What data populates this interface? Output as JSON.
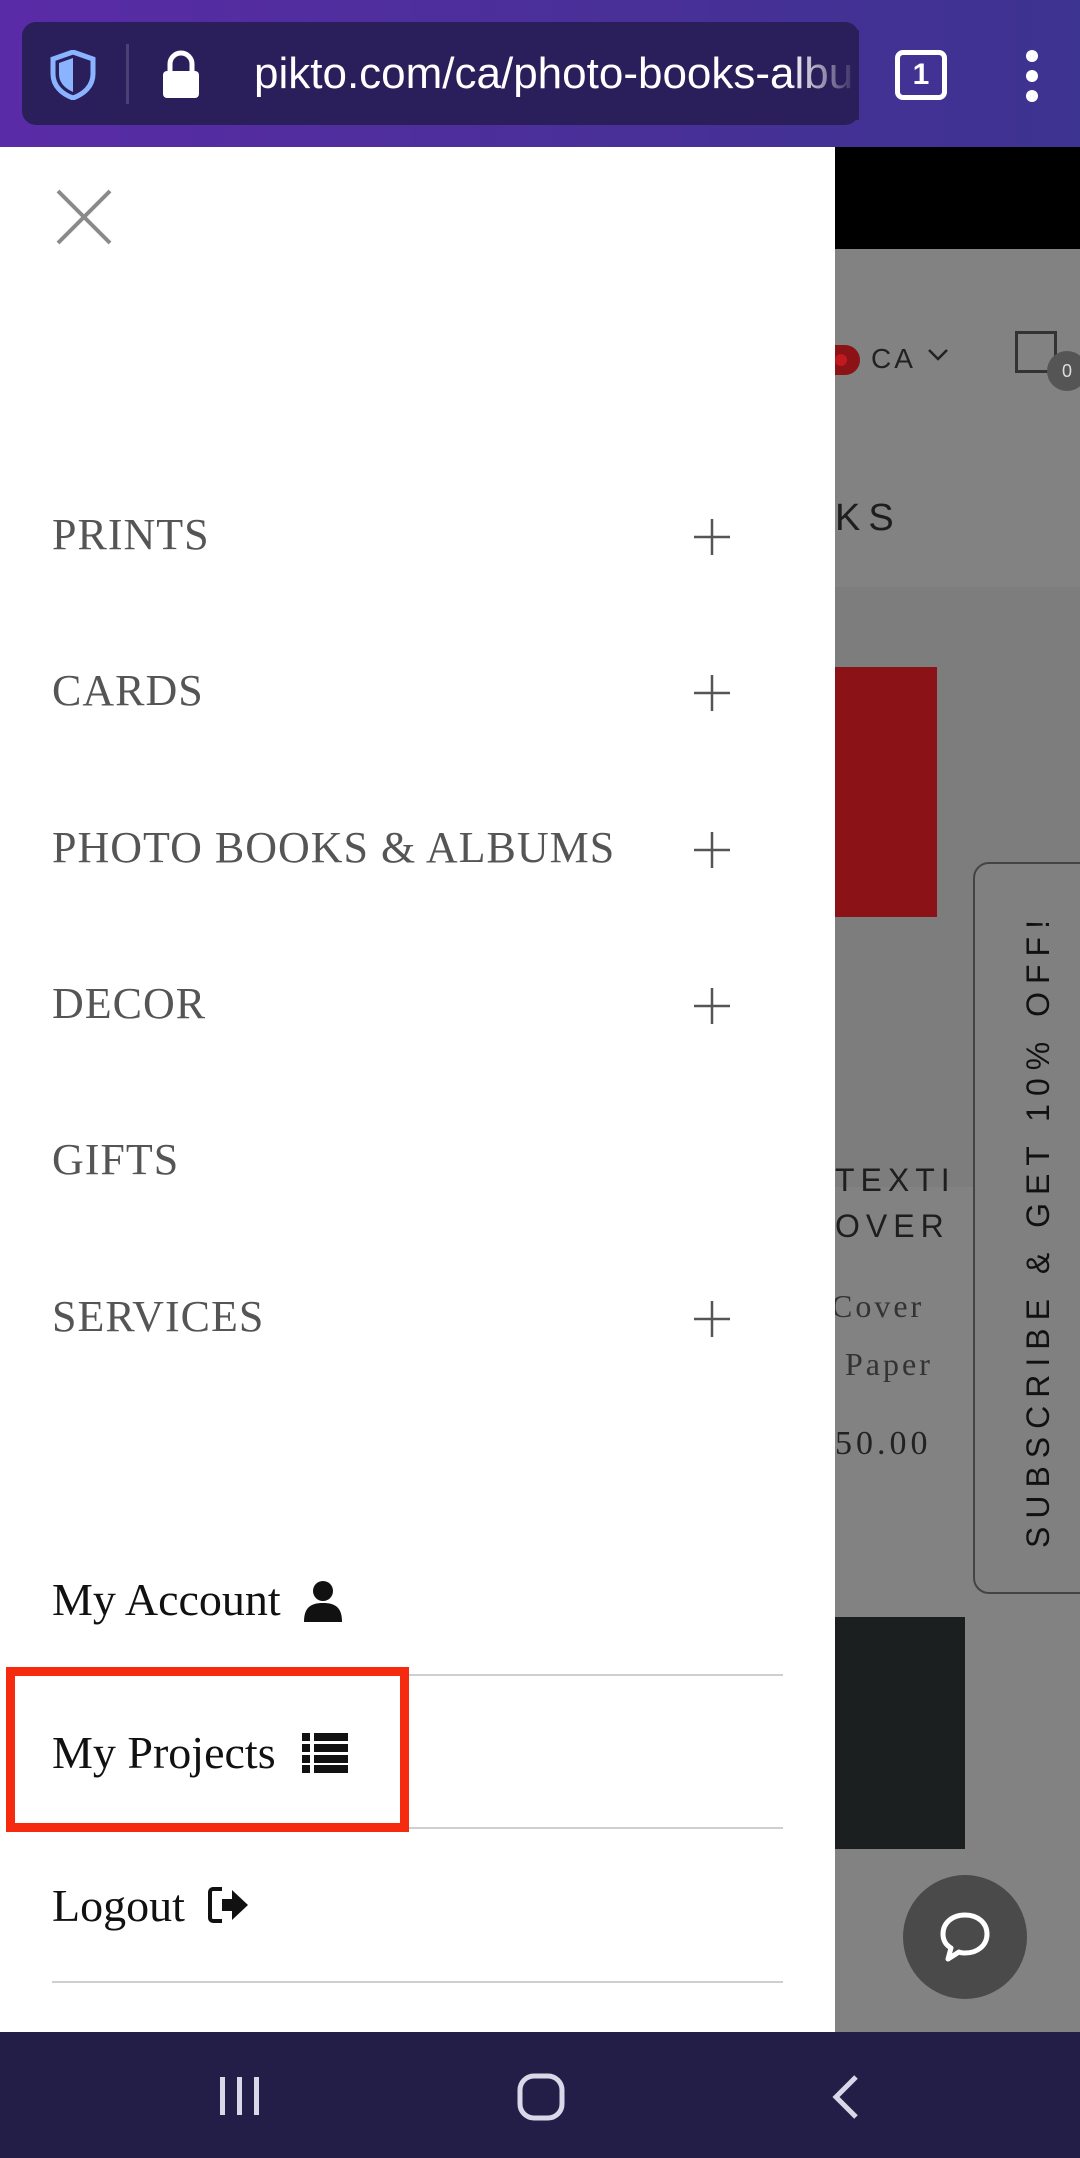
{
  "browser": {
    "url": "pikto.com/ca/photo-books-albu",
    "tab_count": "1"
  },
  "drawer": {
    "menu_items": [
      {
        "label": "PRINTS",
        "expandable": true
      },
      {
        "label": "CARDS",
        "expandable": true
      },
      {
        "label": "PHOTO BOOKS & ALBUMS",
        "expandable": true
      },
      {
        "label": "DECOR",
        "expandable": true
      },
      {
        "label": "GIFTS",
        "expandable": false
      },
      {
        "label": "SERVICES",
        "expandable": true
      }
    ],
    "account_links": [
      {
        "label": "My Account",
        "icon": "user-icon"
      },
      {
        "label": "My Projects",
        "icon": "list-icon"
      },
      {
        "label": "Logout",
        "icon": "logout-icon"
      }
    ]
  },
  "background_page": {
    "country": "CA",
    "cart_count": "0",
    "heading_fragment": "KS",
    "product_title_fragment": [
      "TEXTI",
      "OVER"
    ],
    "product_desc_fragment": [
      "Cover",
      "Paper"
    ],
    "price_fragment": "50.00",
    "subscribe_label": "SUBSCRIBE & GET 10% OFF!"
  },
  "colors": {
    "highlight": "#f52a0f",
    "nav_bar": "#221e48",
    "browser_gradient_start": "#5a2ba6"
  }
}
